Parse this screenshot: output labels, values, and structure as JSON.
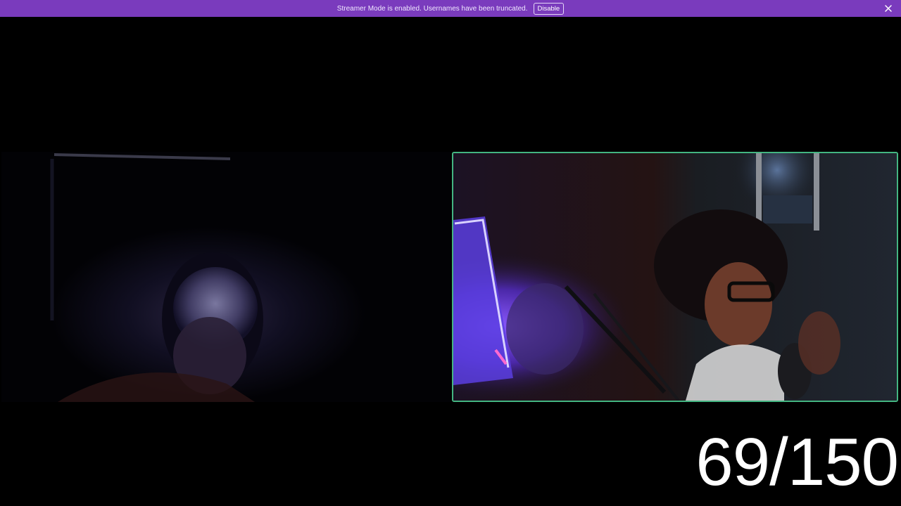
{
  "banner": {
    "message": "Streamer Mode is enabled. Usernames have been truncated.",
    "disable_label": "Disable",
    "close_icon": "close-icon",
    "background": "#7a3bbd"
  },
  "participants": [
    {
      "tile": "left-video",
      "speaking": false
    },
    {
      "tile": "right-video",
      "speaking": true,
      "speaking_border_color": "#43b581"
    }
  ],
  "overlay": {
    "counter_text": "69/150"
  }
}
